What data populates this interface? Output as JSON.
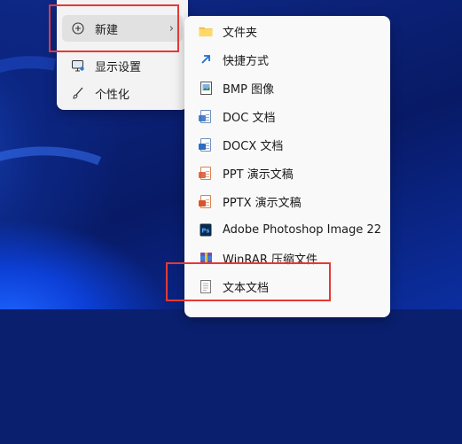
{
  "context_menu": {
    "items": [
      {
        "label": "新建",
        "icon": "plus-circle-icon",
        "has_submenu": true
      },
      {
        "label": "显示设置",
        "icon": "display-settings-icon"
      },
      {
        "label": "个性化",
        "icon": "paintbrush-icon"
      }
    ]
  },
  "submenu": {
    "items": [
      {
        "label": "文件夹",
        "icon": "folder-icon"
      },
      {
        "label": "快捷方式",
        "icon": "shortcut-arrow-icon"
      },
      {
        "label": "BMP 图像",
        "icon": "bmp-image-icon"
      },
      {
        "label": "DOC 文档",
        "icon": "doc-file-icon"
      },
      {
        "label": "DOCX 文档",
        "icon": "docx-file-icon"
      },
      {
        "label": "PPT 演示文稿",
        "icon": "ppt-file-icon"
      },
      {
        "label": "PPTX 演示文稿",
        "icon": "pptx-file-icon"
      },
      {
        "label": "Adobe Photoshop Image 22",
        "icon": "photoshop-file-icon"
      },
      {
        "label": "WinRAR 压缩文件",
        "icon": "winrar-archive-icon"
      },
      {
        "label": "文本文档",
        "icon": "text-document-icon"
      }
    ]
  },
  "colors": {
    "highlight_box": "#e53935",
    "folder": "#f4c04f",
    "shortcut": "#1f6fd1",
    "word": "#2b6cc4",
    "ppt": "#d9542b",
    "photoshop": "#0b2a4a"
  }
}
